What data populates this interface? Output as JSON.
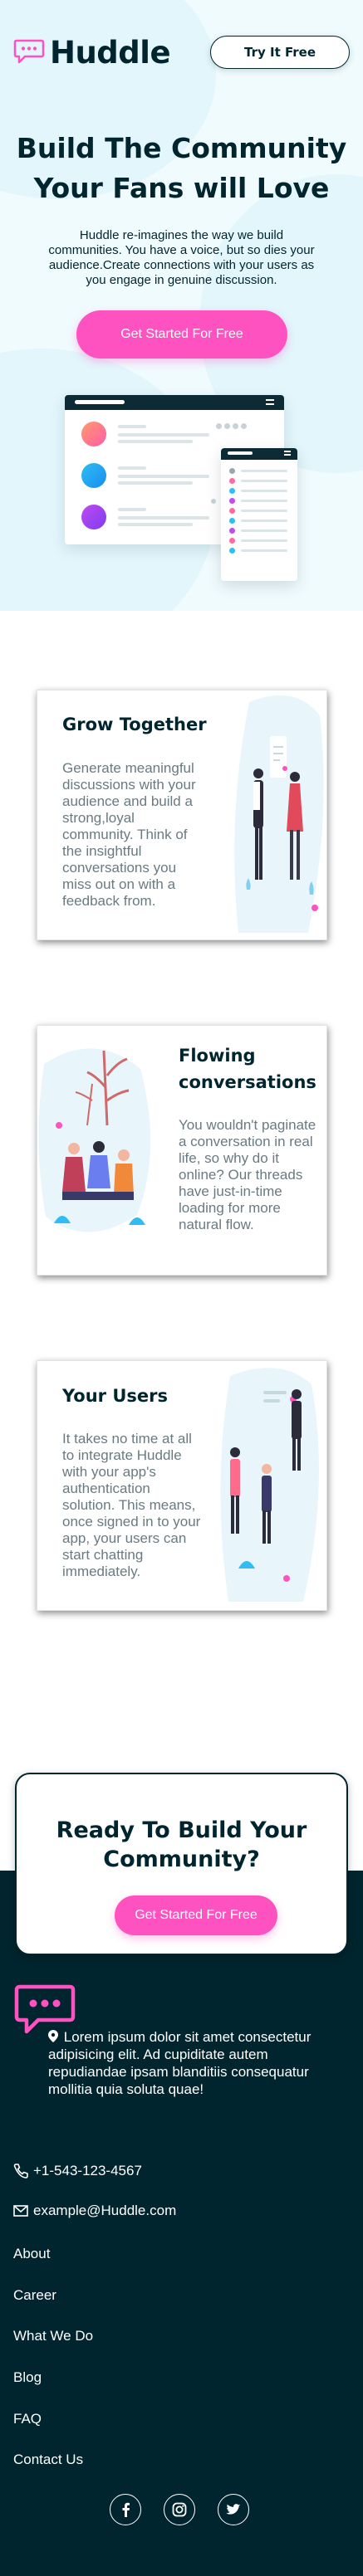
{
  "header": {
    "brand": "Huddle",
    "try_button": "Try It Free"
  },
  "hero": {
    "title_line1": "Build The Community",
    "title_line2": "Your Fans will Love",
    "description": "Huddle re-imagines the way we build communities. You have a voice, but so dies your audience.Create connections with your users as you engage in genuine discussion.",
    "cta": "Get Started For Free"
  },
  "features": [
    {
      "title": "Grow Together",
      "text": "Generate meaningful discussions with your audience and build a strong,loyal community. Think of the insightful conversations you miss out on with a feedback from."
    },
    {
      "title": "Flowing conversations",
      "text": "You wouldn't paginate a conversation in real life, so why do it online? Our threads have just-in-time loading for more natural flow."
    },
    {
      "title": "Your Users",
      "text": "It takes no time at all to integrate Huddle with your app's authentication solution. This means, once signed in to your app, your users can start chatting immediately."
    }
  ],
  "cta": {
    "title": "Ready To Build Your Community?",
    "button": "Get Started For Free"
  },
  "footer": {
    "address": "Lorem ipsum dolor sit amet consectetur adipisicing elit. Ad cupiditate autem repudiandae ipsam blanditiis consequatur mollitia quia soluta quae!",
    "phone": "+1-543-123-4567",
    "email": "example@Huddle.com",
    "links": [
      "About",
      "Career",
      "What We Do",
      "Blog",
      "FAQ",
      "Contact Us"
    ],
    "socials": [
      "facebook-icon",
      "instagram-icon",
      "twitter-icon"
    ]
  },
  "colors": {
    "brand_dark": "#00252e",
    "accent_pink": "#ff52c1",
    "hero_bg": "#f0fbfe",
    "text_muted": "#6b7a80"
  }
}
